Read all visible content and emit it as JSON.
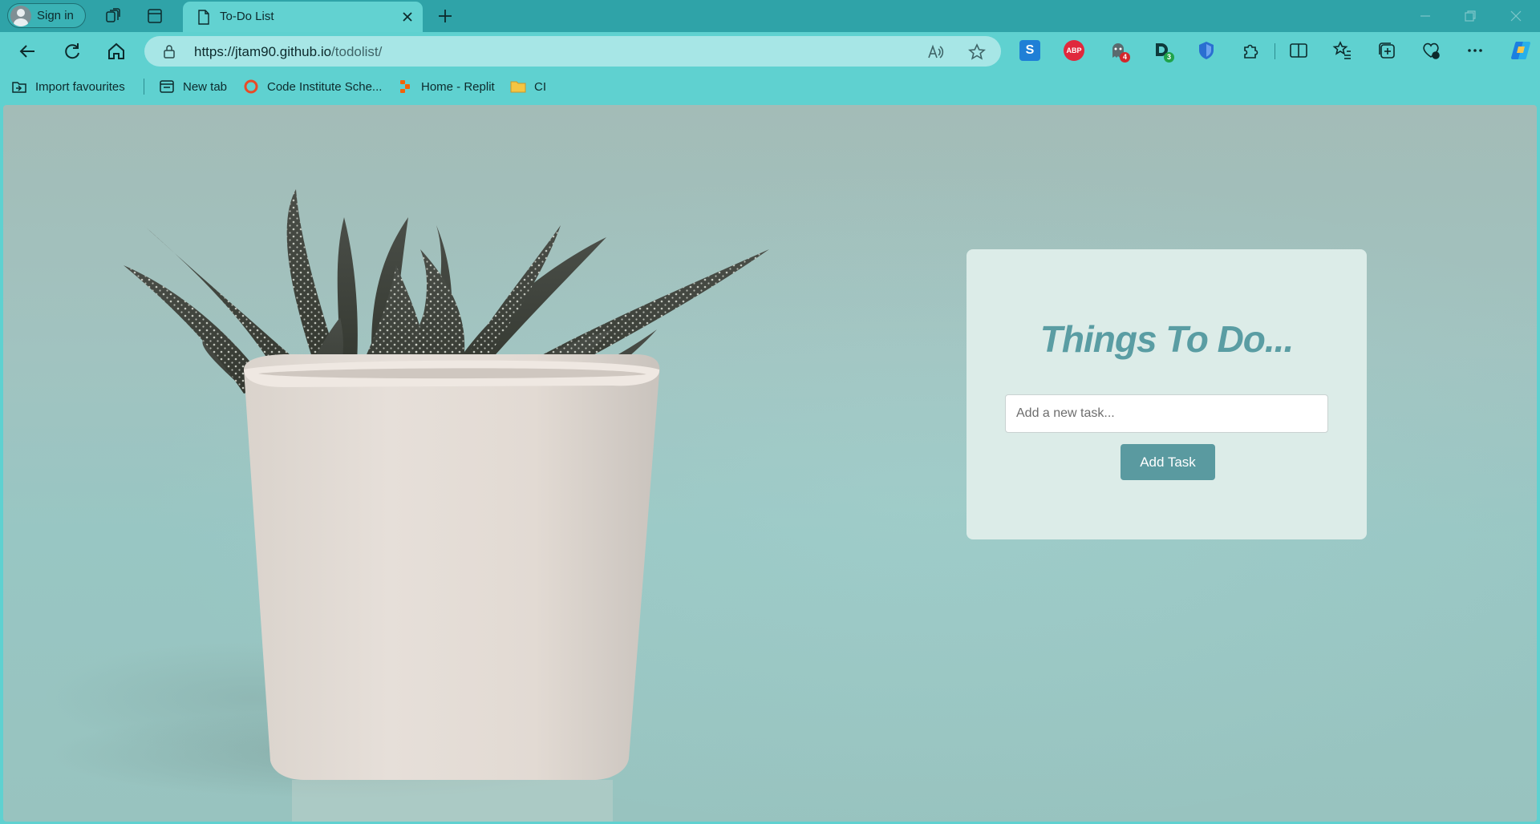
{
  "browser": {
    "signin_label": "Sign in",
    "tab_title": "To-Do List",
    "url_host": "https://jtam90.github.io",
    "url_path": "/todolist/",
    "extensions": [
      {
        "icon": "s-extension-icon"
      },
      {
        "icon": "abp-icon",
        "text": "ABP"
      },
      {
        "icon": "ghostery-icon",
        "badge": "4"
      },
      {
        "icon": "dashlane-icon",
        "badge": "3"
      },
      {
        "icon": "shield-extension-icon"
      }
    ]
  },
  "favourites": [
    {
      "label": "Import favourites",
      "icon": "import-icon"
    },
    {
      "label": "New tab",
      "icon": "newtab-icon"
    },
    {
      "label": "Code Institute Sche...",
      "icon": "code-institute-icon"
    },
    {
      "label": "Home - Replit",
      "icon": "replit-icon"
    },
    {
      "label": "CI",
      "icon": "folder-icon"
    }
  ],
  "app": {
    "title": "Things To Do...",
    "input_placeholder": "Add a new task...",
    "add_button": "Add Task"
  },
  "colors": {
    "titlebar": "#2fa3a8",
    "toolbar": "#5fd1d0",
    "card_bg": "#dcece8",
    "title_color": "#5a9da3",
    "button_bg": "#5a9aa0"
  }
}
